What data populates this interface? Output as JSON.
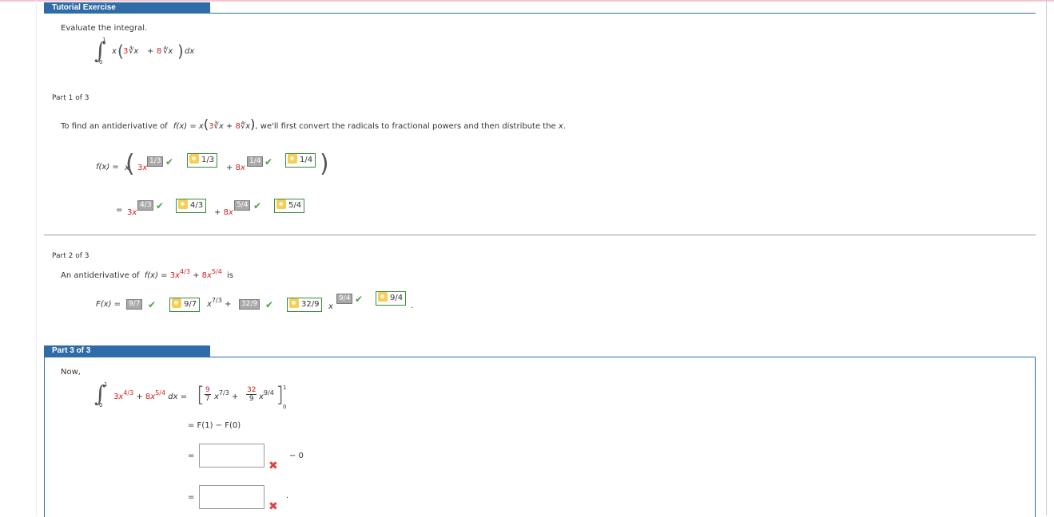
{
  "header": {
    "title": "Tutorial Exercise"
  },
  "problem": {
    "prompt": "Evaluate the integral.",
    "upper": "1",
    "lower": "0",
    "coef1": "3",
    "coef2": "8",
    "root1_index": "3",
    "root2_index": "4",
    "dx": "dx"
  },
  "part1": {
    "title": "Part 1 of 3",
    "text_a": "To find an antiderivative of",
    "text_b": "we'll first convert the radicals to fractional powers and then distribute the",
    "fx": "f(x) =",
    "x_var": "x",
    "row1": {
      "box1": "1/3",
      "key1": "1/3",
      "box2": "1/4",
      "key2": "1/4"
    },
    "row2": {
      "box1": "4/3",
      "key1": "4/3",
      "box2": "5/4",
      "key2": "5/4"
    }
  },
  "part2": {
    "title": "Part 2 of 3",
    "text_a": "An antiderivative of",
    "text_is": "is",
    "Fx": "F(x) =",
    "box1": "9/7",
    "key1": "9/7",
    "exp1": "7/3",
    "box2": "32/9",
    "key2": "32/9",
    "box3": "9/4",
    "key3": "9/4"
  },
  "part3": {
    "title": "Part 3 of 3",
    "now": "Now,",
    "frac1_num": "9",
    "frac1_den": "7",
    "frac2_num": "32",
    "frac2_den": "9",
    "exp_a": "4/3",
    "exp_b": "5/4",
    "exp_c": "7/3",
    "exp_d": "9/4",
    "line2": "= F(1) − F(0)",
    "minus_zero": "− 0",
    "input1_value": "",
    "input2_value": ""
  },
  "colors": {
    "accent": "#2f6ca8",
    "correct": "#4aa24a",
    "incorrect": "#e04040",
    "highlight": "#d02020"
  }
}
